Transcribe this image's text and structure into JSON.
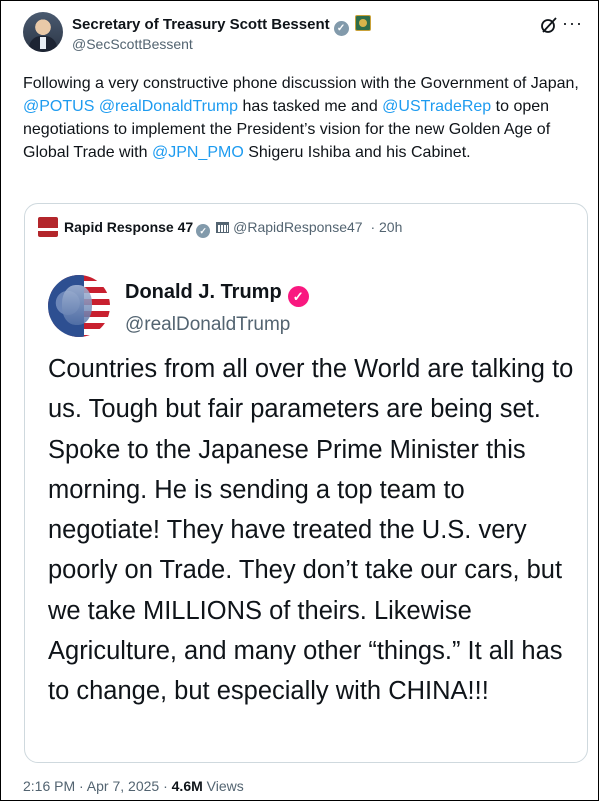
{
  "tweet": {
    "author_name": "Secretary of Treasury Scott Bessent",
    "author_handle": "@SecScottBessent",
    "text_parts": [
      {
        "t": "Following a very constructive phone discussion with the Government of Japan, ",
        "m": false
      },
      {
        "t": "@POTUS",
        "m": true
      },
      {
        "t": " ",
        "m": false
      },
      {
        "t": "@realDonaldTrump",
        "m": true
      },
      {
        "t": " has tasked me and ",
        "m": false
      },
      {
        "t": "@USTradeRep",
        "m": true
      },
      {
        "t": " to open negotiations to implement the President’s vision for the new Golden Age of Global Trade with ",
        "m": false
      },
      {
        "t": "@JPN_PMO",
        "m": true
      },
      {
        "t": " Shigeru Ishiba and his Cabinet.",
        "m": false
      }
    ],
    "timestamp": "2:16 PM · Apr 7, 2025 · ",
    "views_count": "4.6M",
    "views_label": " Views",
    "more_icon": "more-icon",
    "grok_icon": "grok-icon"
  },
  "quote": {
    "author_name": "Rapid Response 47",
    "author_handle": "@RapidResponse47",
    "time_ago": "· 20h",
    "inner": {
      "author_name": "Donald J. Trump",
      "author_handle": "@realDonaldTrump",
      "text": "Countries from all over the World are talking to us. Tough but fair parameters are being set. Spoke to the Japanese Prime Minister this morning. He is sending a top team to negotiate! They have treated the U.S. very poorly on Trade. They don’t take our cars, but we take MILLIONS of theirs. Likewise Agriculture, and many other “things.” It all has to change, but especially with CHINA!!!"
    }
  },
  "colors": {
    "mention": "#1d9bf0",
    "secondary_text": "#536471",
    "verified_gray": "#829aab",
    "verified_pink": "#f91880"
  }
}
